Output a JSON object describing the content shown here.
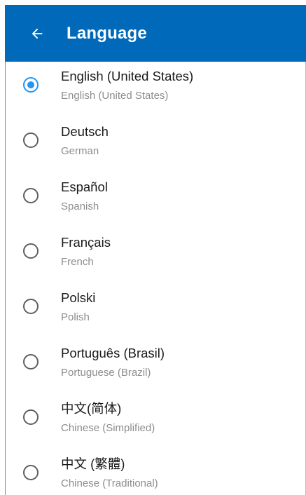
{
  "header": {
    "title": "Language",
    "back_icon": "arrow-left-icon",
    "background": "#0069b9"
  },
  "accent": "#2196f3",
  "languages": [
    {
      "label": "English (United States)",
      "sublabel": "English (United States)",
      "selected": true
    },
    {
      "label": "Deutsch",
      "sublabel": "German",
      "selected": false
    },
    {
      "label": "Español",
      "sublabel": "Spanish",
      "selected": false
    },
    {
      "label": "Français",
      "sublabel": "French",
      "selected": false
    },
    {
      "label": "Polski",
      "sublabel": "Polish",
      "selected": false
    },
    {
      "label": "Português (Brasil)",
      "sublabel": "Portuguese (Brazil)",
      "selected": false
    },
    {
      "label": "中文(简体)",
      "sublabel": "Chinese (Simplified)",
      "selected": false
    },
    {
      "label": "中文 (繁體)",
      "sublabel": "Chinese (Traditional)",
      "selected": false
    }
  ]
}
